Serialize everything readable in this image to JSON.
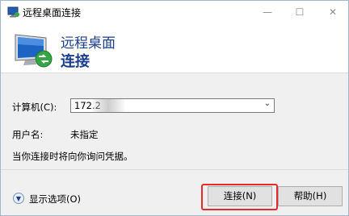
{
  "window": {
    "title": "远程桌面连接",
    "minimize_glyph": "—",
    "maximize_glyph": "☐",
    "close_glyph": "✕"
  },
  "header": {
    "title": "远程桌面",
    "subtitle": "连接",
    "icon": "remote-desktop-monitor-icon"
  },
  "form": {
    "computer_label": "计算机(C):",
    "computer_value": "172.2",
    "username_label": "用户名:",
    "username_value": "未指定",
    "info_text": "当你连接时将向你询问凭据。"
  },
  "footer": {
    "show_options_label": "显示选项(O)",
    "connect_label": "连接(N)",
    "help_label": "帮助(H)"
  },
  "colors": {
    "accent": "#1a3d8c",
    "highlight": "#e52b2b"
  }
}
